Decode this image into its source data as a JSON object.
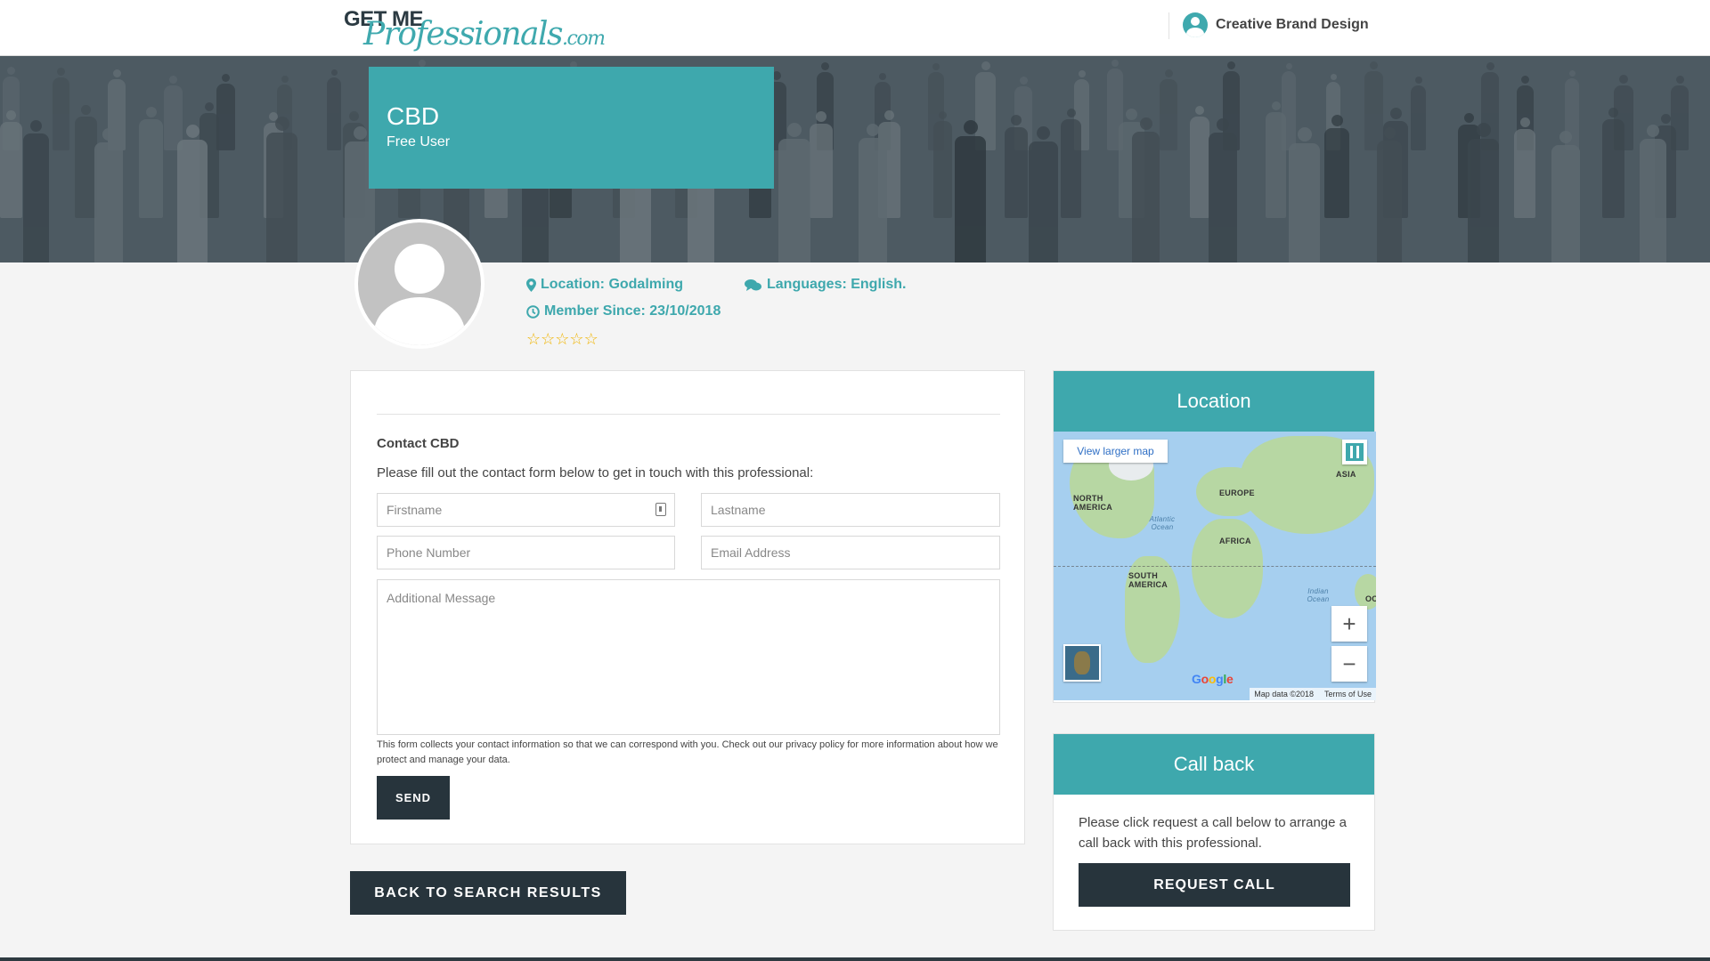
{
  "header": {
    "logo": {
      "line1": "GET ME",
      "line2": "Professionals",
      "line3": ".com"
    },
    "user_name": "Creative Brand Design",
    "user_icon": "user-circle-icon"
  },
  "banner": {
    "name": "CBD",
    "role": "Free User"
  },
  "profile": {
    "location": "Location: Godalming",
    "languages": "Languages: English.",
    "member_since": "Member Since: 23/10/2018",
    "rating": 0,
    "rating_max": 5
  },
  "contact": {
    "title": "Contact CBD",
    "intro": "Please fill out the contact form below to get in touch with this professional:",
    "firstname_placeholder": "Firstname",
    "lastname_placeholder": "Lastname",
    "phone_placeholder": "Phone Number",
    "email_placeholder": "Email Address",
    "message_placeholder": "Additional Message",
    "disclaimer": "This form collects your contact information so that we can correspond with you. Check out our privacy policy for more information about how we protect and manage your data.",
    "send_label": "SEND"
  },
  "back_label": "BACK TO SEARCH RESULTS",
  "location_card": {
    "title": "Location",
    "view_larger": "View larger map",
    "labels": {
      "north_america": "NORTH AMERICA",
      "south_america": "SOUTH AMERICA",
      "europe": "EUROPE",
      "africa": "AFRICA",
      "asia": "ASIA",
      "atlantic": "Atlantic Ocean",
      "indian": "Indian Ocean",
      "oc": "OC"
    },
    "zoom_in": "+",
    "zoom_out": "−",
    "google": "Google",
    "map_data": "Map data ©2018",
    "terms": "Terms of Use"
  },
  "callback_card": {
    "title": "Call back",
    "text": "Please click request a call below to arrange a call back with this professional.",
    "button_label": "REQUEST CALL"
  },
  "colors": {
    "accent": "#3ea8ad",
    "dark": "#27343c",
    "banner_bg": "#4d5a62"
  }
}
